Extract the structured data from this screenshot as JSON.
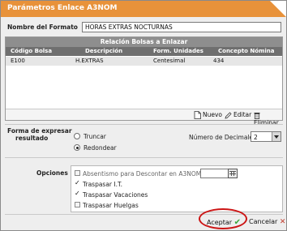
{
  "window": {
    "title": "Parámetros Enlace A3NOM"
  },
  "format_name": {
    "label": "Nombre del Formato",
    "value": "HORAS EXTRAS NOCTURNAS"
  },
  "table": {
    "title": "Relación Bolsas a Enlazar",
    "columns": [
      "Código Bolsa",
      "Descripción",
      "Form. Unidades",
      "Concepto Nómina"
    ],
    "rows": [
      [
        "E100",
        "H.EXTRAS",
        "Centesimal",
        "434"
      ]
    ],
    "actions": {
      "new": "Nuevo",
      "edit": "Editar",
      "delete": "Eliminar"
    }
  },
  "result_format": {
    "label_line1": "Forma de expresar",
    "label_line2": "resultado",
    "options": [
      {
        "label": "Truncar",
        "selected": false
      },
      {
        "label": "Redondear",
        "selected": true
      }
    ],
    "decimals_label": "Número de Decimales",
    "decimals_value": "2"
  },
  "options": {
    "label": "Opciones",
    "items": [
      {
        "label": "Absentismo para Descontar en A3NOM",
        "checked": false,
        "enabled": false
      },
      {
        "label": "Traspasar I.T.",
        "checked": true,
        "enabled": true
      },
      {
        "label": "Traspasar Vacaciones",
        "checked": true,
        "enabled": true
      },
      {
        "label": "Traspasar Huelgas",
        "checked": false,
        "enabled": true
      }
    ]
  },
  "footer": {
    "accept": "Aceptar",
    "cancel": "Cancelar"
  },
  "colors": {
    "title_bar": "#e8923a",
    "accept_check": "#3aa53a",
    "cancel_x": "#c23b2b",
    "highlight": "#cc1515"
  }
}
